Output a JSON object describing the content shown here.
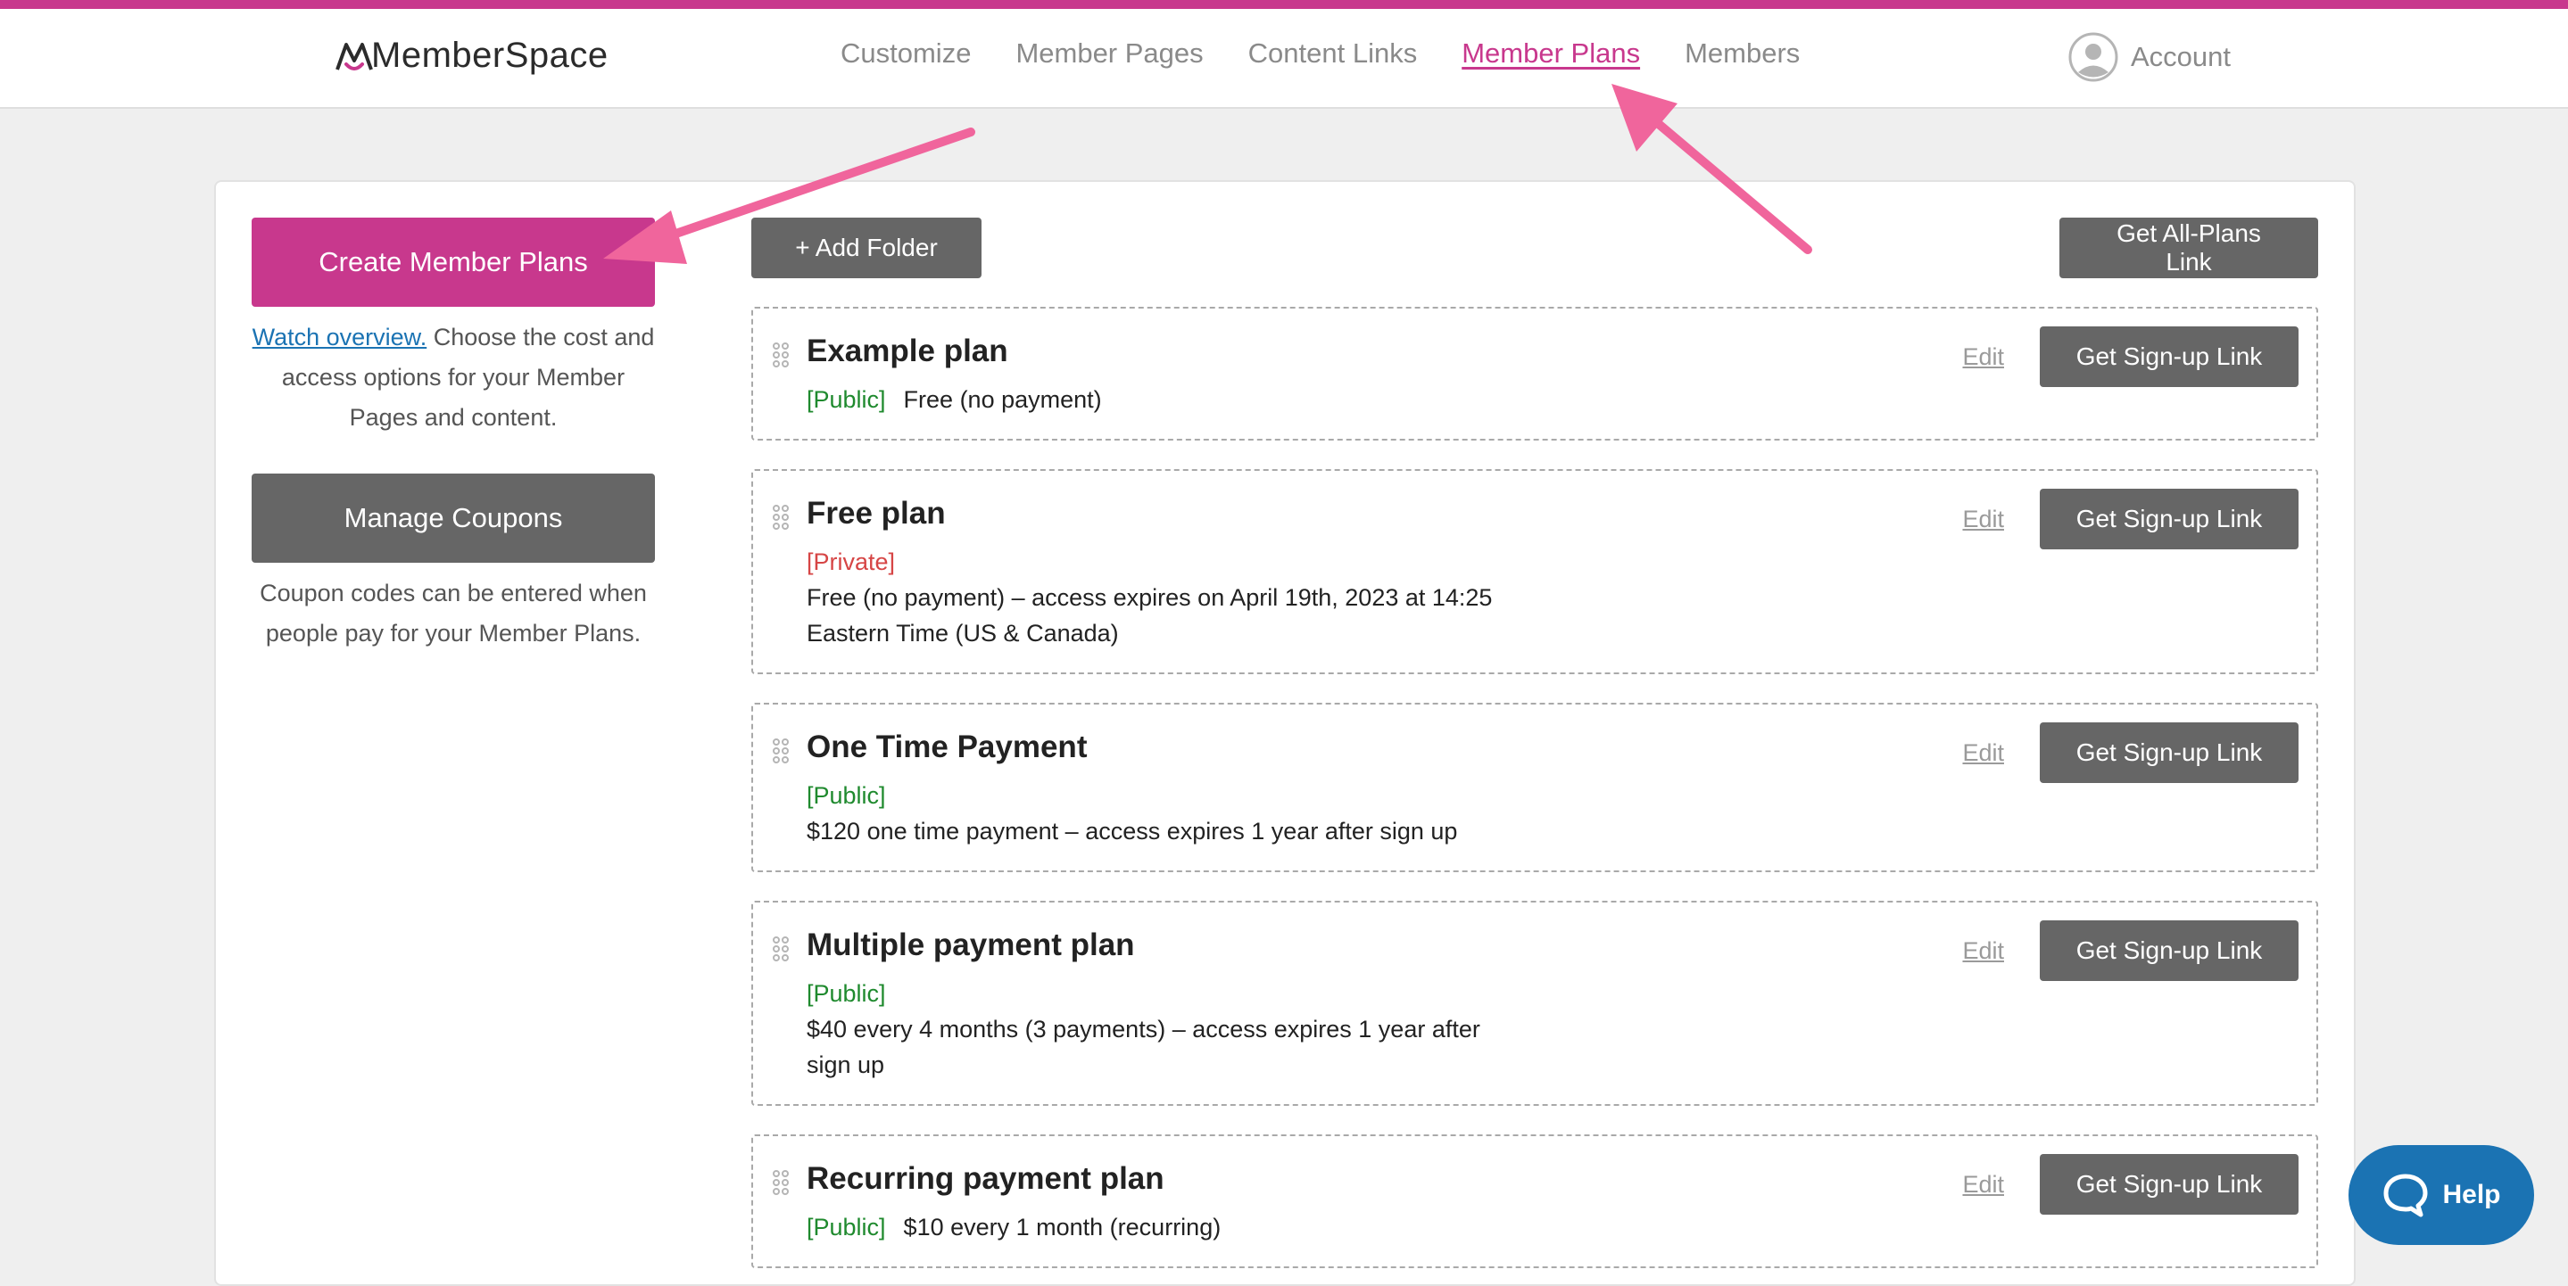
{
  "colors": {
    "brand": "#c8388d",
    "button_gray": "#666666",
    "public_tag": "#1f8a2e",
    "private_tag": "#d64545",
    "help": "#1b73b3",
    "annotation_arrow": "#f0659c"
  },
  "header": {
    "logo_text": "MemberSpace",
    "nav": {
      "customize": "Customize",
      "member_pages": "Member Pages",
      "content_links": "Content Links",
      "member_plans": "Member Plans",
      "members": "Members"
    },
    "active_tab": "Member Plans",
    "account_label": "Account",
    "account_icon": "user-avatar-icon"
  },
  "sidebar": {
    "create_label": "Create Member Plans",
    "watch_link": "Watch overview.",
    "create_description": " Choose the cost and access options for your Member Pages and content.",
    "coupons_label": "Manage Coupons",
    "coupons_description": "Coupon codes can be entered when people pay for your Member Plans."
  },
  "toolbar": {
    "add_folder_label": "+ Add Folder",
    "all_plans_label": "Get All-Plans Link"
  },
  "plans": [
    {
      "title": "Example plan",
      "visibility": "[Public]",
      "details": "Free (no payment)"
    },
    {
      "title": "Free plan",
      "visibility": "[Private]",
      "details": "Free (no payment) – access expires on April 19th, 2023 at 14:25 Eastern Time (US & Canada)"
    },
    {
      "title": "One Time Payment",
      "visibility": "[Public]",
      "details": "$120 one time payment – access expires 1 year after sign up"
    },
    {
      "title": "Multiple payment plan",
      "visibility": "[Public]",
      "details": "$40 every 4 months (3 payments) – access expires 1 year after sign up"
    },
    {
      "title": "Recurring payment plan",
      "visibility": "[Public]",
      "details": "$10 every 1 month (recurring)"
    }
  ],
  "plan_actions": {
    "edit_label": "Edit",
    "signup_label": "Get Sign-up Link"
  },
  "help": {
    "label": "Help",
    "icon": "chat-bubble-icon"
  }
}
